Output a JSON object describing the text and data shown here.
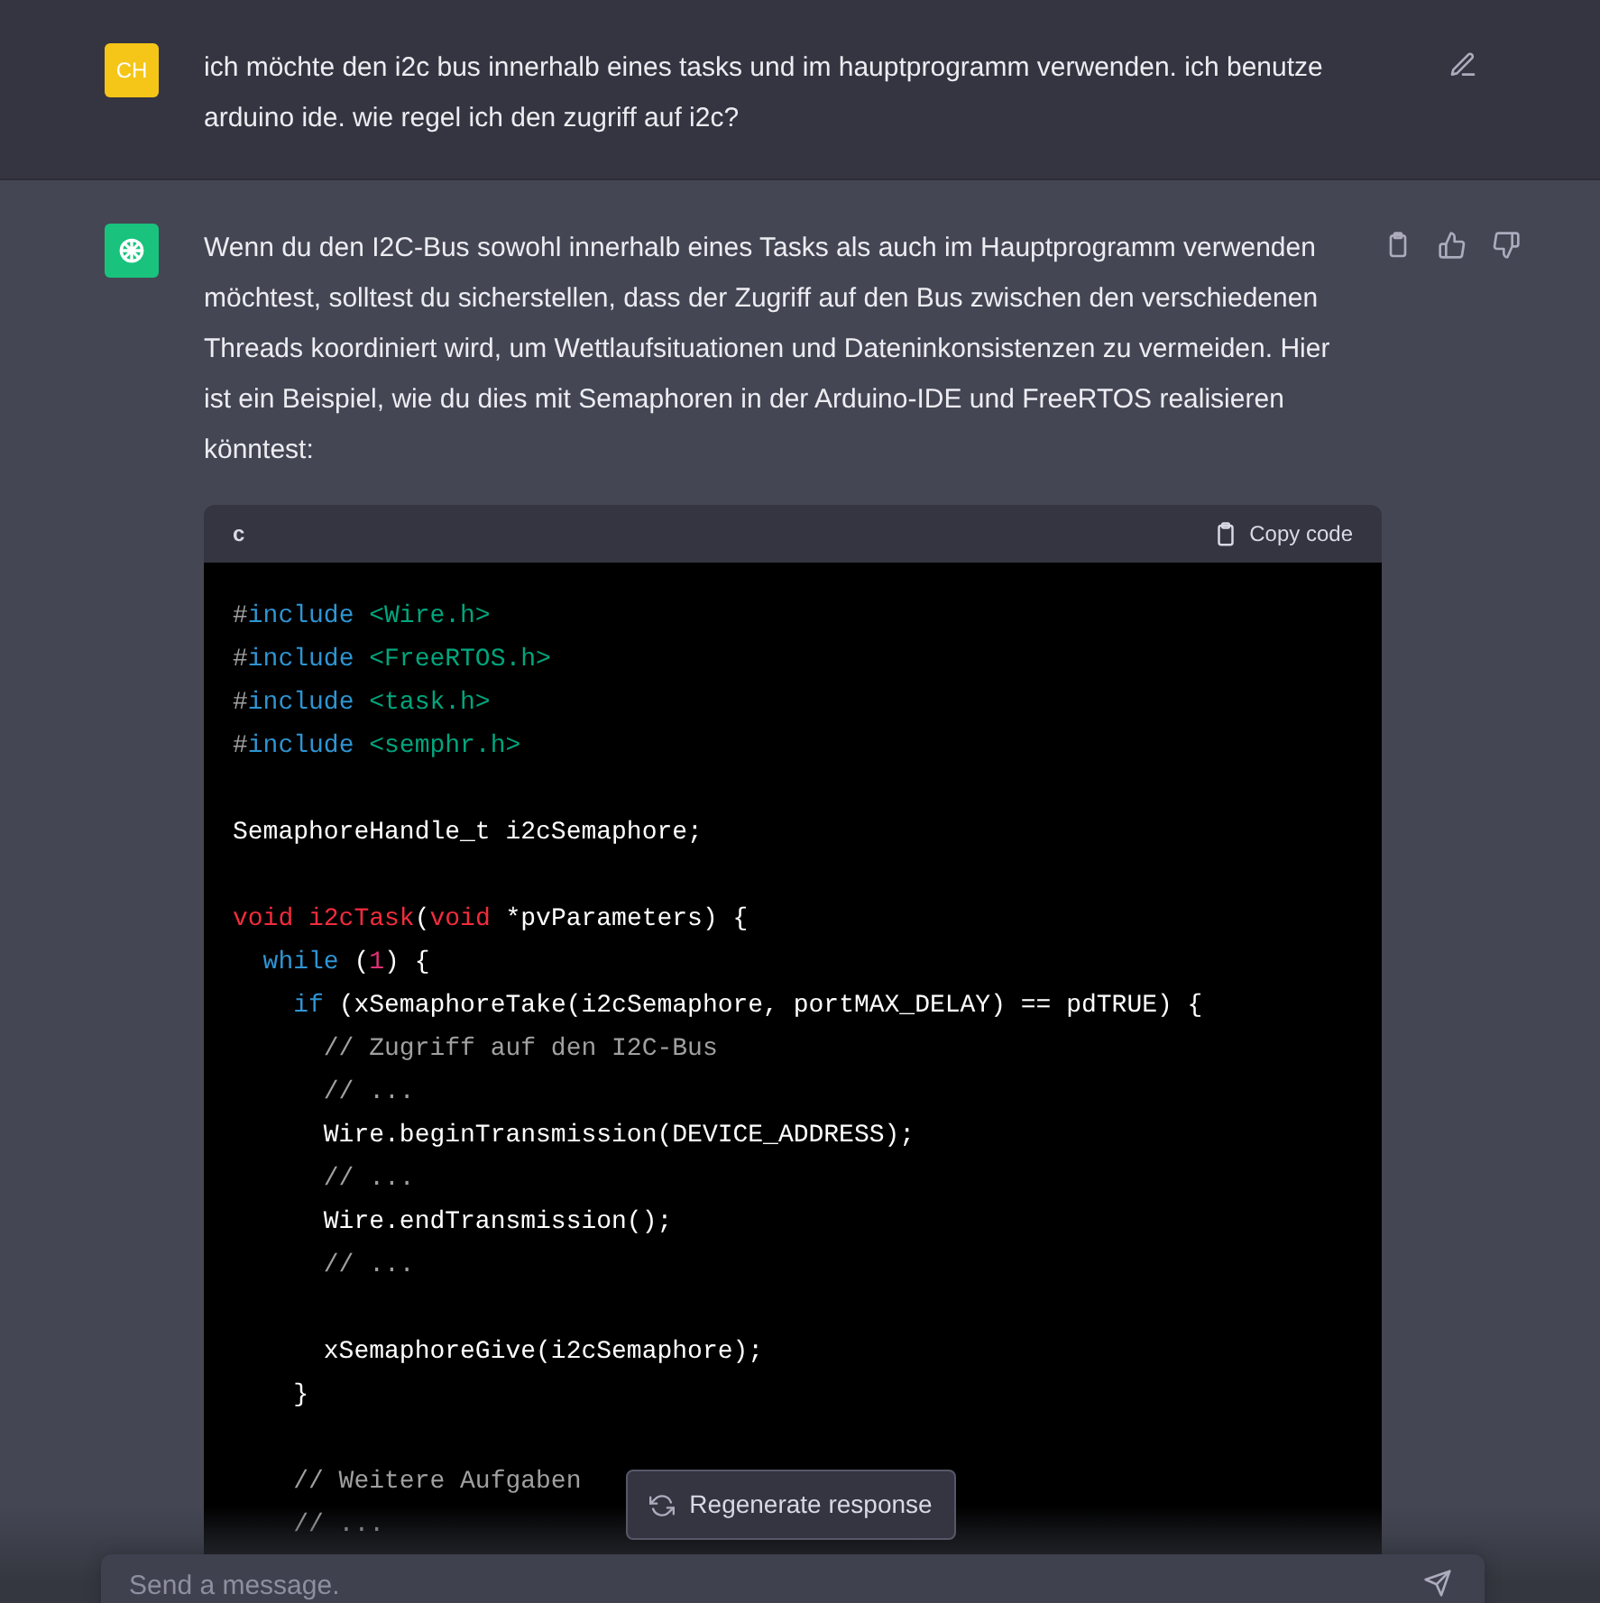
{
  "user_message": {
    "avatar": "CH",
    "text": "ich möchte den i2c bus innerhalb eines tasks und im hauptprogramm verwenden. ich benutze arduino ide. wie regel ich den zugriff auf i2c?"
  },
  "assistant_message": {
    "text": "Wenn du den I2C-Bus sowohl innerhalb eines Tasks als auch im Hauptprogramm verwenden möchtest, solltest du sicherstellen, dass der Zugriff auf den Bus zwischen den verschiedenen Threads koordiniert wird, um Wettlaufsituationen und Dateninkonsistenzen zu vermeiden. Hier ist ein Beispiel, wie du dies mit Semaphoren in der Arduino-IDE und FreeRTOS realisieren könntest:",
    "code_block": {
      "language": "c",
      "copy_label": "Copy code",
      "lines": [
        {
          "kind": "code",
          "tokens": [
            {
              "t": "#",
              "kind": "meta"
            },
            {
              "t": "include",
              "kind": "keyword"
            },
            {
              "t": " <Wire.h>",
              "kind": "string"
            }
          ]
        },
        {
          "kind": "code",
          "tokens": [
            {
              "t": "#",
              "kind": "meta"
            },
            {
              "t": "include",
              "kind": "keyword"
            },
            {
              "t": " <FreeRTOS.h>",
              "kind": "string"
            }
          ]
        },
        {
          "kind": "code",
          "tokens": [
            {
              "t": "#",
              "kind": "meta"
            },
            {
              "t": "include",
              "kind": "keyword"
            },
            {
              "t": " <task.h>",
              "kind": "string"
            }
          ]
        },
        {
          "kind": "code",
          "tokens": [
            {
              "t": "#",
              "kind": "meta"
            },
            {
              "t": "include",
              "kind": "keyword"
            },
            {
              "t": " <semphr.h>",
              "kind": "string"
            }
          ]
        },
        {
          "kind": "blank"
        },
        {
          "kind": "code",
          "tokens": [
            {
              "t": "SemaphoreHandle_t i2cSemaphore;",
              "kind": "plain"
            }
          ]
        },
        {
          "kind": "blank"
        },
        {
          "kind": "code",
          "tokens": [
            {
              "t": "void i2cTask",
              "kind": "function"
            },
            {
              "t": "(",
              "kind": "plain"
            },
            {
              "t": "void",
              "kind": "function"
            },
            {
              "t": " *pvParameters) {",
              "kind": "plain"
            }
          ]
        },
        {
          "kind": "code",
          "tokens": [
            {
              "t": "  while",
              "kind": "keyword"
            },
            {
              "t": " (",
              "kind": "plain"
            },
            {
              "t": "1",
              "kind": "number"
            },
            {
              "t": ") {",
              "kind": "plain"
            }
          ]
        },
        {
          "kind": "code",
          "tokens": [
            {
              "t": "    if",
              "kind": "keyword"
            },
            {
              "t": " (xSemaphoreTake(i2cSemaphore, portMAX_DELAY) == pdTRUE) {",
              "kind": "plain"
            }
          ]
        },
        {
          "kind": "code",
          "tokens": [
            {
              "t": "      // Zugriff auf den I2C-Bus",
              "kind": "comment"
            }
          ]
        },
        {
          "kind": "code",
          "tokens": [
            {
              "t": "      // ...",
              "kind": "comment"
            }
          ]
        },
        {
          "kind": "code",
          "tokens": [
            {
              "t": "      Wire.beginTransmission(DEVICE_ADDRESS);",
              "kind": "plain"
            }
          ]
        },
        {
          "kind": "code",
          "tokens": [
            {
              "t": "      // ...",
              "kind": "comment"
            }
          ]
        },
        {
          "kind": "code",
          "tokens": [
            {
              "t": "      Wire.endTransmission();",
              "kind": "plain"
            }
          ]
        },
        {
          "kind": "code",
          "tokens": [
            {
              "t": "      // ...",
              "kind": "comment"
            }
          ]
        },
        {
          "kind": "blank"
        },
        {
          "kind": "code",
          "tokens": [
            {
              "t": "      xSemaphoreGive(i2cSemaphore);",
              "kind": "plain"
            }
          ]
        },
        {
          "kind": "code",
          "tokens": [
            {
              "t": "    }",
              "kind": "plain"
            }
          ]
        },
        {
          "kind": "blank"
        },
        {
          "kind": "code",
          "tokens": [
            {
              "t": "    // Weitere Aufgaben",
              "kind": "comment"
            }
          ]
        },
        {
          "kind": "code",
          "tokens": [
            {
              "t": "    // ...",
              "kind": "comment"
            }
          ]
        }
      ]
    }
  },
  "regenerate_button": "Regenerate response",
  "composer": {
    "placeholder": "Send a message."
  }
}
